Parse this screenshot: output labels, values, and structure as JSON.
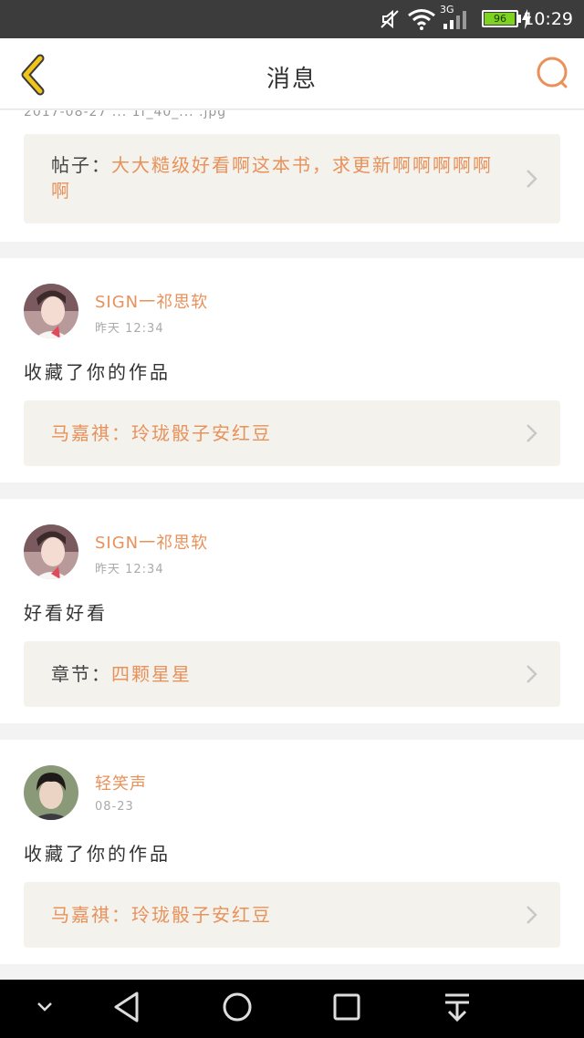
{
  "status_bar": {
    "time": "10:29",
    "battery": "96",
    "battery_level_percent": 96,
    "network": "3G",
    "icons": [
      "mute-icon",
      "wifi-icon",
      "signal-icon",
      "battery-icon",
      "charging-icon"
    ]
  },
  "header": {
    "title": "消息",
    "back_icon": "chevron-left-icon",
    "search_icon": "search-icon"
  },
  "colors": {
    "accent": "#e8915a",
    "back_yellow": "#f0c419",
    "quote_bg": "#f3f2ed"
  },
  "cut_text": "2017-08-27 ... 1f_40_... .jpg",
  "items": [
    {
      "quote_label": "帖子：",
      "quote_text": "大大糙级好看啊这本书，求更新啊啊啊啊啊啊"
    },
    {
      "user": "SIGN一祁思软",
      "time": "昨天 12:34",
      "message": "收藏了你的作品",
      "quote_label": "马嘉祺：",
      "quote_text": "玲珑骰子安红豆"
    },
    {
      "user": "SIGN一祁思软",
      "time": "昨天 12:34",
      "message": "好看好看",
      "quote_label": "章节：",
      "quote_text": "四颗星星"
    },
    {
      "user": "轻笑声",
      "time": "08-23",
      "message": "收藏了你的作品",
      "quote_label": "马嘉祺：",
      "quote_text": "玲珑骰子安红豆"
    }
  ],
  "nav_bar": [
    "chevron-down-icon",
    "back-triangle-icon",
    "home-circle-icon",
    "recents-square-icon",
    "notification-pull-icon"
  ]
}
